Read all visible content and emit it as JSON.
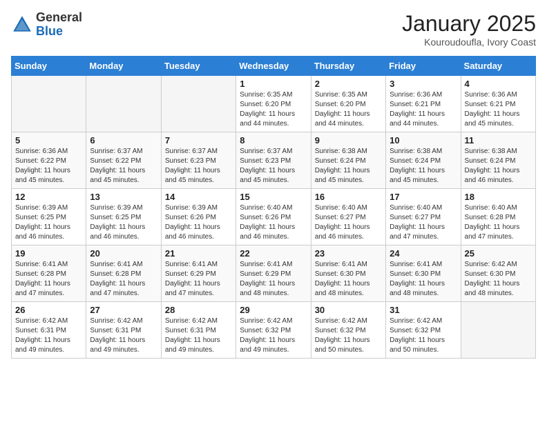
{
  "header": {
    "logo_general": "General",
    "logo_blue": "Blue",
    "month_title": "January 2025",
    "location": "Kouroudoufla, Ivory Coast"
  },
  "days_of_week": [
    "Sunday",
    "Monday",
    "Tuesday",
    "Wednesday",
    "Thursday",
    "Friday",
    "Saturday"
  ],
  "weeks": [
    [
      {
        "day": "",
        "sunrise": "",
        "sunset": "",
        "daylight": "",
        "empty": true
      },
      {
        "day": "",
        "sunrise": "",
        "sunset": "",
        "daylight": "",
        "empty": true
      },
      {
        "day": "",
        "sunrise": "",
        "sunset": "",
        "daylight": "",
        "empty": true
      },
      {
        "day": "1",
        "sunrise": "Sunrise: 6:35 AM",
        "sunset": "Sunset: 6:20 PM",
        "daylight": "Daylight: 11 hours and 44 minutes.",
        "empty": false
      },
      {
        "day": "2",
        "sunrise": "Sunrise: 6:35 AM",
        "sunset": "Sunset: 6:20 PM",
        "daylight": "Daylight: 11 hours and 44 minutes.",
        "empty": false
      },
      {
        "day": "3",
        "sunrise": "Sunrise: 6:36 AM",
        "sunset": "Sunset: 6:21 PM",
        "daylight": "Daylight: 11 hours and 44 minutes.",
        "empty": false
      },
      {
        "day": "4",
        "sunrise": "Sunrise: 6:36 AM",
        "sunset": "Sunset: 6:21 PM",
        "daylight": "Daylight: 11 hours and 45 minutes.",
        "empty": false
      }
    ],
    [
      {
        "day": "5",
        "sunrise": "Sunrise: 6:36 AM",
        "sunset": "Sunset: 6:22 PM",
        "daylight": "Daylight: 11 hours and 45 minutes.",
        "empty": false
      },
      {
        "day": "6",
        "sunrise": "Sunrise: 6:37 AM",
        "sunset": "Sunset: 6:22 PM",
        "daylight": "Daylight: 11 hours and 45 minutes.",
        "empty": false
      },
      {
        "day": "7",
        "sunrise": "Sunrise: 6:37 AM",
        "sunset": "Sunset: 6:23 PM",
        "daylight": "Daylight: 11 hours and 45 minutes.",
        "empty": false
      },
      {
        "day": "8",
        "sunrise": "Sunrise: 6:37 AM",
        "sunset": "Sunset: 6:23 PM",
        "daylight": "Daylight: 11 hours and 45 minutes.",
        "empty": false
      },
      {
        "day": "9",
        "sunrise": "Sunrise: 6:38 AM",
        "sunset": "Sunset: 6:24 PM",
        "daylight": "Daylight: 11 hours and 45 minutes.",
        "empty": false
      },
      {
        "day": "10",
        "sunrise": "Sunrise: 6:38 AM",
        "sunset": "Sunset: 6:24 PM",
        "daylight": "Daylight: 11 hours and 45 minutes.",
        "empty": false
      },
      {
        "day": "11",
        "sunrise": "Sunrise: 6:38 AM",
        "sunset": "Sunset: 6:24 PM",
        "daylight": "Daylight: 11 hours and 46 minutes.",
        "empty": false
      }
    ],
    [
      {
        "day": "12",
        "sunrise": "Sunrise: 6:39 AM",
        "sunset": "Sunset: 6:25 PM",
        "daylight": "Daylight: 11 hours and 46 minutes.",
        "empty": false
      },
      {
        "day": "13",
        "sunrise": "Sunrise: 6:39 AM",
        "sunset": "Sunset: 6:25 PM",
        "daylight": "Daylight: 11 hours and 46 minutes.",
        "empty": false
      },
      {
        "day": "14",
        "sunrise": "Sunrise: 6:39 AM",
        "sunset": "Sunset: 6:26 PM",
        "daylight": "Daylight: 11 hours and 46 minutes.",
        "empty": false
      },
      {
        "day": "15",
        "sunrise": "Sunrise: 6:40 AM",
        "sunset": "Sunset: 6:26 PM",
        "daylight": "Daylight: 11 hours and 46 minutes.",
        "empty": false
      },
      {
        "day": "16",
        "sunrise": "Sunrise: 6:40 AM",
        "sunset": "Sunset: 6:27 PM",
        "daylight": "Daylight: 11 hours and 46 minutes.",
        "empty": false
      },
      {
        "day": "17",
        "sunrise": "Sunrise: 6:40 AM",
        "sunset": "Sunset: 6:27 PM",
        "daylight": "Daylight: 11 hours and 47 minutes.",
        "empty": false
      },
      {
        "day": "18",
        "sunrise": "Sunrise: 6:40 AM",
        "sunset": "Sunset: 6:28 PM",
        "daylight": "Daylight: 11 hours and 47 minutes.",
        "empty": false
      }
    ],
    [
      {
        "day": "19",
        "sunrise": "Sunrise: 6:41 AM",
        "sunset": "Sunset: 6:28 PM",
        "daylight": "Daylight: 11 hours and 47 minutes.",
        "empty": false
      },
      {
        "day": "20",
        "sunrise": "Sunrise: 6:41 AM",
        "sunset": "Sunset: 6:28 PM",
        "daylight": "Daylight: 11 hours and 47 minutes.",
        "empty": false
      },
      {
        "day": "21",
        "sunrise": "Sunrise: 6:41 AM",
        "sunset": "Sunset: 6:29 PM",
        "daylight": "Daylight: 11 hours and 47 minutes.",
        "empty": false
      },
      {
        "day": "22",
        "sunrise": "Sunrise: 6:41 AM",
        "sunset": "Sunset: 6:29 PM",
        "daylight": "Daylight: 11 hours and 48 minutes.",
        "empty": false
      },
      {
        "day": "23",
        "sunrise": "Sunrise: 6:41 AM",
        "sunset": "Sunset: 6:30 PM",
        "daylight": "Daylight: 11 hours and 48 minutes.",
        "empty": false
      },
      {
        "day": "24",
        "sunrise": "Sunrise: 6:41 AM",
        "sunset": "Sunset: 6:30 PM",
        "daylight": "Daylight: 11 hours and 48 minutes.",
        "empty": false
      },
      {
        "day": "25",
        "sunrise": "Sunrise: 6:42 AM",
        "sunset": "Sunset: 6:30 PM",
        "daylight": "Daylight: 11 hours and 48 minutes.",
        "empty": false
      }
    ],
    [
      {
        "day": "26",
        "sunrise": "Sunrise: 6:42 AM",
        "sunset": "Sunset: 6:31 PM",
        "daylight": "Daylight: 11 hours and 49 minutes.",
        "empty": false
      },
      {
        "day": "27",
        "sunrise": "Sunrise: 6:42 AM",
        "sunset": "Sunset: 6:31 PM",
        "daylight": "Daylight: 11 hours and 49 minutes.",
        "empty": false
      },
      {
        "day": "28",
        "sunrise": "Sunrise: 6:42 AM",
        "sunset": "Sunset: 6:31 PM",
        "daylight": "Daylight: 11 hours and 49 minutes.",
        "empty": false
      },
      {
        "day": "29",
        "sunrise": "Sunrise: 6:42 AM",
        "sunset": "Sunset: 6:32 PM",
        "daylight": "Daylight: 11 hours and 49 minutes.",
        "empty": false
      },
      {
        "day": "30",
        "sunrise": "Sunrise: 6:42 AM",
        "sunset": "Sunset: 6:32 PM",
        "daylight": "Daylight: 11 hours and 50 minutes.",
        "empty": false
      },
      {
        "day": "31",
        "sunrise": "Sunrise: 6:42 AM",
        "sunset": "Sunset: 6:32 PM",
        "daylight": "Daylight: 11 hours and 50 minutes.",
        "empty": false
      },
      {
        "day": "",
        "sunrise": "",
        "sunset": "",
        "daylight": "",
        "empty": true
      }
    ]
  ]
}
